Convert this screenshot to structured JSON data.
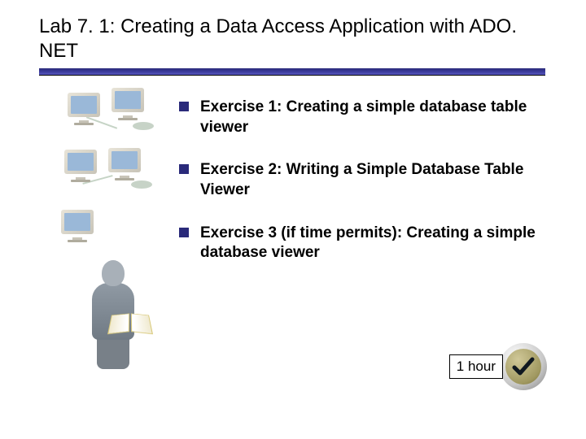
{
  "title": "Lab 7. 1: Creating a Data Access Application with ADO. NET",
  "bullets": [
    "Exercise 1: Creating a simple database table viewer",
    "Exercise 2: Writing a Simple Database Table Viewer",
    "Exercise 3 (if time permits): Creating a simple database viewer"
  ],
  "time_label": "1 hour"
}
